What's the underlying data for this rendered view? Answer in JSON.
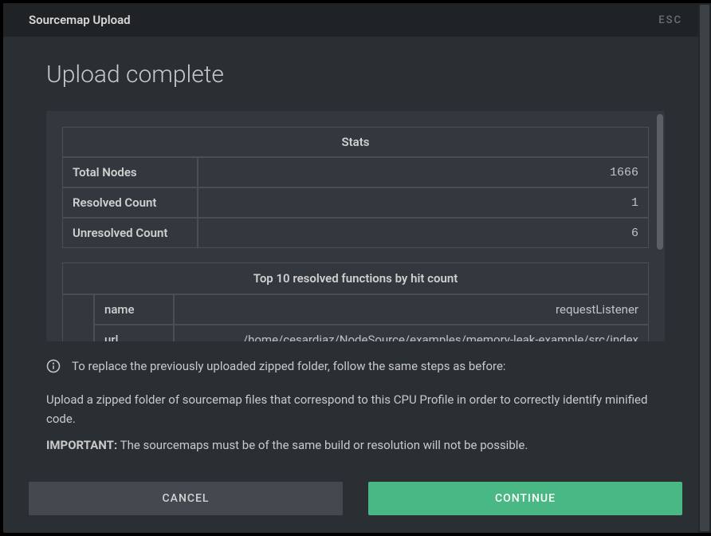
{
  "header": {
    "title": "Sourcemap Upload",
    "esc_label": "ESC"
  },
  "heading": "Upload complete",
  "stats_table": {
    "header": "Stats",
    "rows": [
      {
        "label": "Total Nodes",
        "value": "1666"
      },
      {
        "label": "Resolved Count",
        "value": "1"
      },
      {
        "label": "Unresolved Count",
        "value": "6"
      }
    ]
  },
  "functions_table": {
    "header": "Top 10 resolved functions by hit count",
    "rows": [
      {
        "key": "name",
        "value": "requestListener"
      },
      {
        "key": "url",
        "value": "/home/cesardiaz/NodeSource/examples/memory-leak-example/src/index"
      }
    ]
  },
  "info": {
    "replace_hint": "To replace the previously uploaded zipped folder, follow the same steps as before:",
    "upload_para": "Upload a zipped folder of sourcemap files that correspond to this CPU Profile in order to correctly identify minified code.",
    "important_label": "IMPORTANT:",
    "important_text": " The sourcemaps must be of the same build or resolution will not be possible."
  },
  "footer": {
    "cancel": "CANCEL",
    "continue": "CONTINUE"
  }
}
